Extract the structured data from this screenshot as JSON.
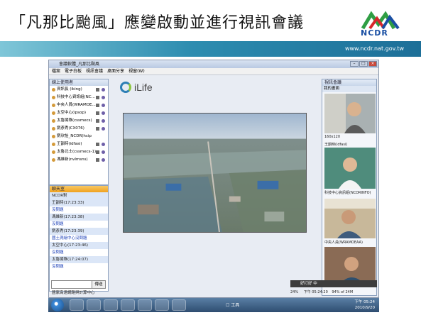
{
  "slide": {
    "title": "「凡那比颱風」應變啟動並進行視訊會議",
    "logo_text": "NCDR",
    "url": "www.ncdr.nat.gov.tw"
  },
  "window": {
    "title": "會議軟體_凡那比颱風",
    "menu": [
      "檔案",
      "電子白板",
      "視訊會議",
      "桌面分享",
      "視窗(W)"
    ],
    "app_logo": "iLife"
  },
  "users_panel": {
    "title": "線上使用者",
    "items": [
      "資訊長 (iking)",
      "科技中心資訊組(NC...",
      "中央人員(WRAMOE...",
      "太空中心(ipsop)",
      "太魯閣隊(cssmecs)",
      "劉彥秀(CX076)",
      "劉欣怡_NCDR(hcip",
      "王韻時(idfasi)",
      "太魯北士(cssmecs-1)",
      "馮維新(nvlmsns)"
    ]
  },
  "chat_panel": {
    "title": "聊天室",
    "lines": [
      {
        "kind": "name",
        "text": "NCDR對"
      },
      {
        "kind": "name",
        "text": "王韻時(17:23:33)"
      },
      {
        "kind": "msg",
        "text": "沒問題"
      },
      {
        "kind": "name",
        "text": "馮維新(17:23:38)"
      },
      {
        "kind": "msg",
        "text": "沒問題"
      },
      {
        "kind": "name",
        "text": "劉彥秀(17:23:39)"
      },
      {
        "kind": "msg",
        "text": "國土測繪中心沒問題"
      },
      {
        "kind": "name",
        "text": "太空中心(17:23:46)"
      },
      {
        "kind": "msg",
        "text": "沒問題"
      },
      {
        "kind": "name",
        "text": "太魯閣隊(17:24:07)"
      },
      {
        "kind": "msg",
        "text": "沒問題"
      }
    ],
    "send_label": "傳送"
  },
  "video_panel": {
    "title": "視訊會議",
    "top_label": "我的畫面",
    "captions": [
      "王韻時(idfasi)",
      "科技中心資訊組(NCDRINFO)",
      "中央人員(WRAMOEAA)"
    ],
    "resolution": "160x120"
  },
  "footer": {
    "app_name": "國家高速網路與計算中心",
    "status_text": "好打好 中",
    "time_left": "下午 05:24:20",
    "progress": "94% of 24M",
    "zoom": "24%"
  },
  "taskbar": {
    "tool_label": "☐ 工具",
    "clock_time": "下午 05:24",
    "clock_date": "2010/9/20"
  },
  "colors": {
    "band": "#2d8db0",
    "chat_head": "#f0a21f",
    "chat_msg": "#1a3fb8"
  }
}
